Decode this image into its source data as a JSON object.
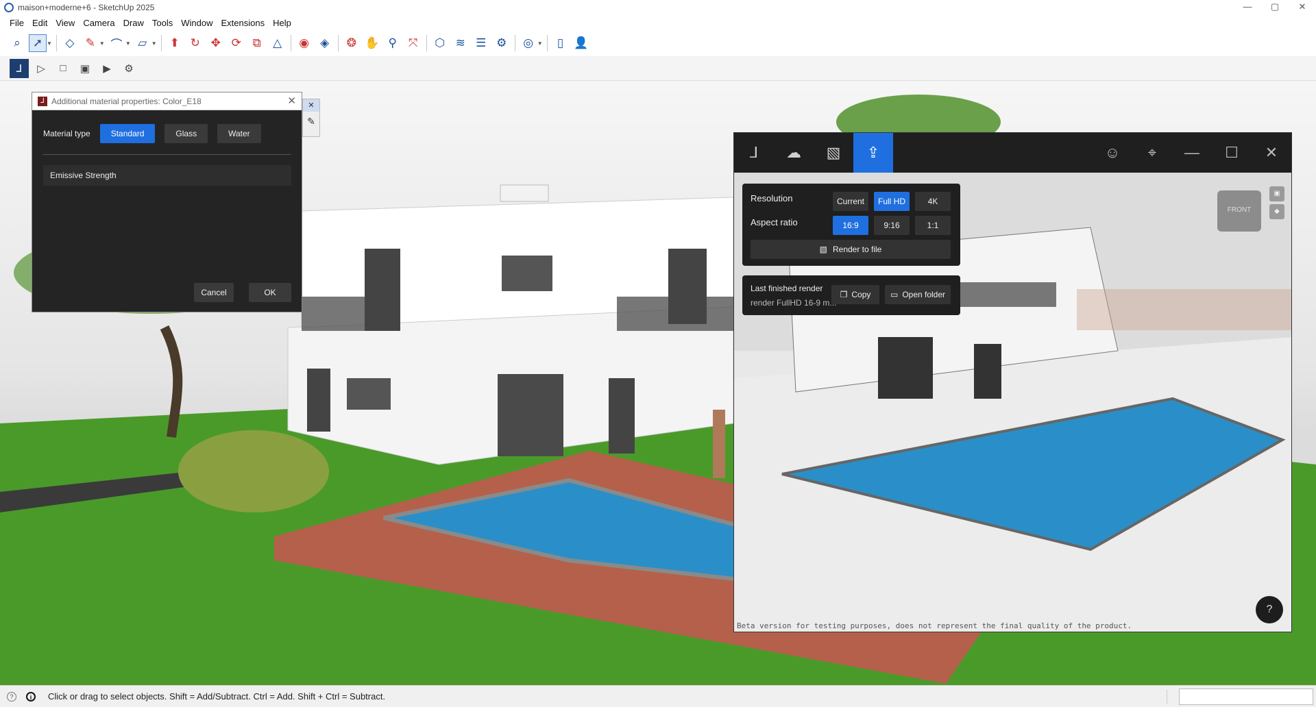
{
  "window": {
    "title": "maison+moderne+6 - SketchUp 2025",
    "controls": [
      "—",
      "▢",
      "✕"
    ]
  },
  "menu": [
    "File",
    "Edit",
    "View",
    "Camera",
    "Draw",
    "Tools",
    "Window",
    "Extensions",
    "Help"
  ],
  "material_dialog": {
    "title": "Additional material properties: Color_E18",
    "material_type_label": "Material type",
    "types": [
      "Standard",
      "Glass",
      "Water"
    ],
    "selected_type": "Standard",
    "emissive_label": "Emissive Strength",
    "cancel": "Cancel",
    "ok": "OK"
  },
  "render_panel": {
    "resolution_label": "Resolution",
    "resolution_options": [
      "Current",
      "Full HD",
      "4K"
    ],
    "resolution_selected": "Full HD",
    "aspect_label": "Aspect ratio",
    "aspect_options": [
      "16:9",
      "9:16",
      "1:1"
    ],
    "aspect_selected": "16:9",
    "render_button": "Render to file",
    "last_render_label": "Last finished render",
    "last_render_file": "render FullHD 16-9 m...",
    "copy": "Copy",
    "open_folder": "Open folder",
    "beta_notice": "Beta version for testing purposes, does not represent the final quality of the product.",
    "help": "?",
    "cube_label": "FRONT"
  },
  "status": {
    "text": "Click or drag to select objects. Shift = Add/Subtract. Ctrl = Add. Shift + Ctrl = Subtract."
  },
  "colors": {
    "accent": "#1f6fe0",
    "grass": "#4a9a2a",
    "deck": "#b5604a",
    "pool": "#2a8fc8",
    "panel_dark": "#1f1f1f"
  }
}
